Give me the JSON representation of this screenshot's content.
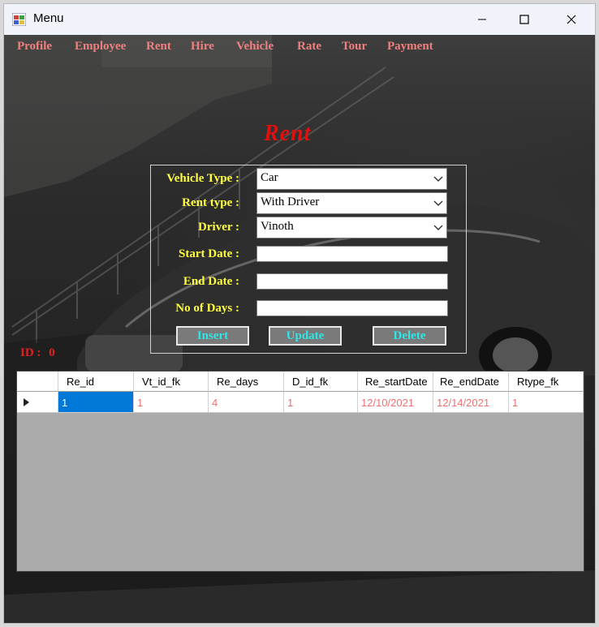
{
  "window": {
    "title": "Menu"
  },
  "menu": [
    "Profile",
    "Employee",
    "Rent",
    "Hire",
    "Vehicle",
    "Rate",
    "Tour",
    "Payment"
  ],
  "form": {
    "heading": "Rent",
    "vehicle_type_label": "Vehicle Type :",
    "vehicle_type_value": "Car",
    "rent_type_label": "Rent type :",
    "rent_type_value": "With Driver",
    "driver_label": "Driver :",
    "driver_value": "Vinoth",
    "start_date_label": "Start Date :",
    "start_date_value": "",
    "end_date_label": "End Date :",
    "end_date_value": "",
    "no_of_days_label": "No of Days :",
    "no_of_days_value": "",
    "insert_label": "Insert",
    "update_label": "Update",
    "delete_label": "Delete",
    "id_label": "ID :",
    "id_value": "0"
  },
  "grid": {
    "columns": [
      "Re_id",
      "Vt_id_fk",
      "Re_days",
      "D_id_fk",
      "Re_startDate",
      "Re_endDate",
      "Rtype_fk"
    ],
    "rows": [
      [
        "1",
        "1",
        "4",
        "1",
        "12/10/2021",
        "12/14/2021",
        "1"
      ]
    ]
  },
  "colors": {
    "menu_text": "#f08080",
    "label_text": "#ffff40",
    "heading_text": "#e01010",
    "button_text": "#2ee8e8",
    "cell_text": "#f07070",
    "selection": "#0078d7"
  }
}
